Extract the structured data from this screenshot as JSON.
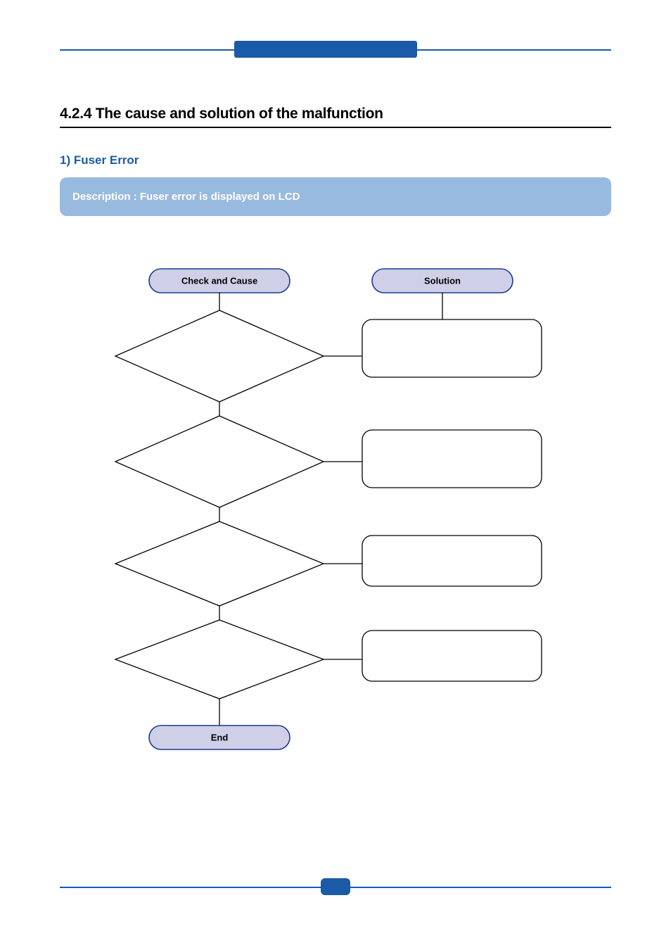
{
  "section_heading": "4.2.4 The cause and solution of the malfunction",
  "subsection_heading": "1) Fuser Error",
  "description_label": "Description :  Fuser error is displayed on LCD",
  "flowchart": {
    "check_cause_label": "Check and Cause",
    "solution_label": "Solution",
    "end_label": "End",
    "decisions": [
      "",
      "",
      "",
      ""
    ],
    "solutions": [
      "",
      "",
      "",
      ""
    ]
  },
  "colors": {
    "brand_blue": "#1a5aa8",
    "light_blue": "#99badf",
    "pill_fill": "#cfd0e8"
  }
}
